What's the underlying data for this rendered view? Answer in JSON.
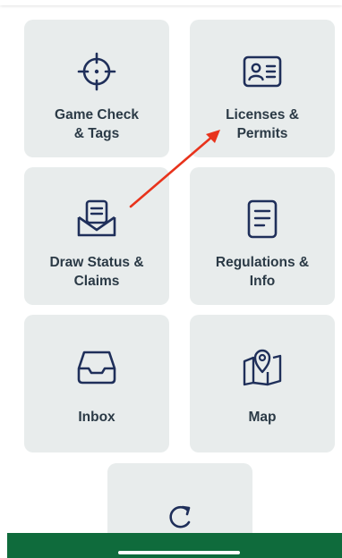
{
  "tiles": {
    "game_check": {
      "label": "Game Check\n& Tags",
      "icon": "crosshair-icon"
    },
    "licenses": {
      "label": "Licenses &\nPermits",
      "icon": "id-card-icon"
    },
    "draw_status": {
      "label": "Draw Status &\nClaims",
      "icon": "envelope-icon"
    },
    "regulations": {
      "label": "Regulations &\nInfo",
      "icon": "document-icon"
    },
    "inbox": {
      "label": "Inbox",
      "icon": "inbox-tray-icon"
    },
    "map": {
      "label": "Map",
      "icon": "map-pin-icon"
    },
    "refresh": {
      "label": "",
      "icon": "refresh-icon"
    }
  },
  "colors": {
    "tile_bg": "#e8ecec",
    "icon_stroke": "#1f2f5a",
    "label_text": "#2b3a46",
    "bottom_bar": "#0f6b3c",
    "annotation_arrow": "#e8331c"
  }
}
